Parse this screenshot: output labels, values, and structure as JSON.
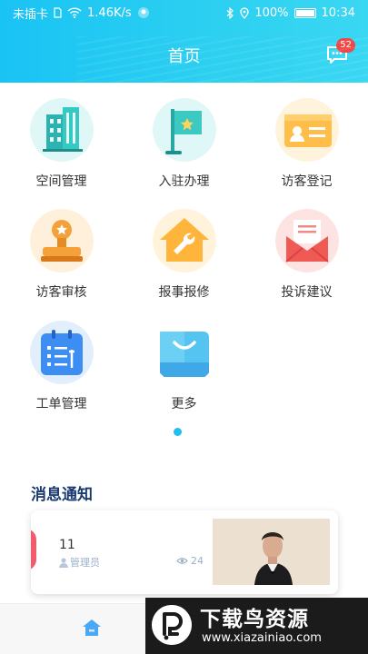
{
  "status_bar": {
    "carrier": "未插卡",
    "speed": "1.46K/s",
    "battery": "100%",
    "time": "10:34"
  },
  "header": {
    "title": "首页",
    "message_badge": "52"
  },
  "grid": {
    "items": [
      {
        "label": "空间管理",
        "icon": "building-icon"
      },
      {
        "label": "入驻办理",
        "icon": "flag-icon"
      },
      {
        "label": "访客登记",
        "icon": "id-card-icon"
      },
      {
        "label": "访客审核",
        "icon": "stamp-icon"
      },
      {
        "label": "报事报修",
        "icon": "wrench-house-icon"
      },
      {
        "label": "投诉建议",
        "icon": "envelope-icon"
      },
      {
        "label": "工单管理",
        "icon": "clipboard-icon"
      },
      {
        "label": "更多",
        "icon": "bag-icon"
      }
    ]
  },
  "news": {
    "section_title": "消息通知",
    "items": [
      {
        "title": "11",
        "author": "管理员",
        "views": "24"
      }
    ]
  },
  "watermark": {
    "title": "下载鸟资源",
    "url": "www.xiazainiao.com"
  },
  "colors": {
    "header": "#1fc4f3",
    "accent": "#1fbfef",
    "section_title": "#1a3a70"
  }
}
